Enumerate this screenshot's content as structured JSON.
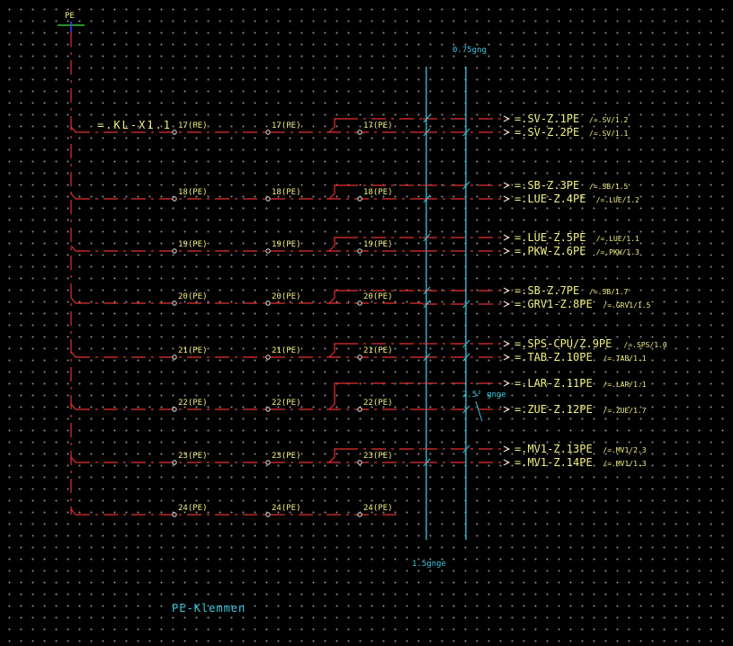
{
  "pe_label": "PE",
  "strip_label": "=.KL-X1.1",
  "footer_label": "PE-Klemmen",
  "cable_labels": {
    "top": "0.75gng",
    "mid": "2.5² gnge",
    "bottom": "1.5gnge"
  },
  "terminals": [
    {
      "label": "17(PE)",
      "outputs": [
        {
          "name": "=.SV-Z.1PE",
          "ref": "/=.SV/1.2"
        },
        {
          "name": "=.SV-Z.2PE",
          "ref": "/=.SV/1.1"
        }
      ]
    },
    {
      "label": "18(PE)",
      "outputs": [
        {
          "name": "=.SB-Z.3PE",
          "ref": "/=.SB/1.5"
        },
        {
          "name": "=.LUE-Z.4PE",
          "ref": "/=.LUE/1.2"
        }
      ]
    },
    {
      "label": "19(PE)",
      "outputs": [
        {
          "name": "=.LUE-Z.5PE",
          "ref": "/=.LUE/1.1"
        },
        {
          "name": "=.PKW-Z.6PE",
          "ref": "/=.PKW/1.3"
        }
      ]
    },
    {
      "label": "20(PE)",
      "outputs": [
        {
          "name": "=.SB-Z.7PE",
          "ref": "/=.SB/1.7"
        },
        {
          "name": "=.GRV1-Z.8PE",
          "ref": "/=.GRV1/1.5"
        }
      ]
    },
    {
      "label": "21(PE)",
      "outputs": [
        {
          "name": "=.SPS-CPU/Z.9PE",
          "ref": "/=.SPS/1.0"
        },
        {
          "name": "=.TAB-Z.10PE",
          "ref": "/=.TAB/1.1"
        }
      ]
    },
    {
      "label": "22(PE)",
      "outputs": [
        {
          "name": "=.LAR-Z.11PE",
          "ref": "/=.LAR/1.1"
        },
        {
          "name": "=.ZUE-Z.12PE",
          "ref": "/=.ZUE/1.7"
        }
      ]
    },
    {
      "label": "23(PE)",
      "outputs": [
        {
          "name": "=.MV1-Z.13PE",
          "ref": "/=.MV1/2.3"
        },
        {
          "name": "=.MV1-Z.14PE",
          "ref": "/=.MV1/1.3"
        }
      ]
    },
    {
      "label": "24(PE)",
      "outputs": []
    }
  ],
  "colors": {
    "wire": "#e83030",
    "cable": "#38c8e0",
    "text": "#f0f080",
    "background": "#000000"
  }
}
